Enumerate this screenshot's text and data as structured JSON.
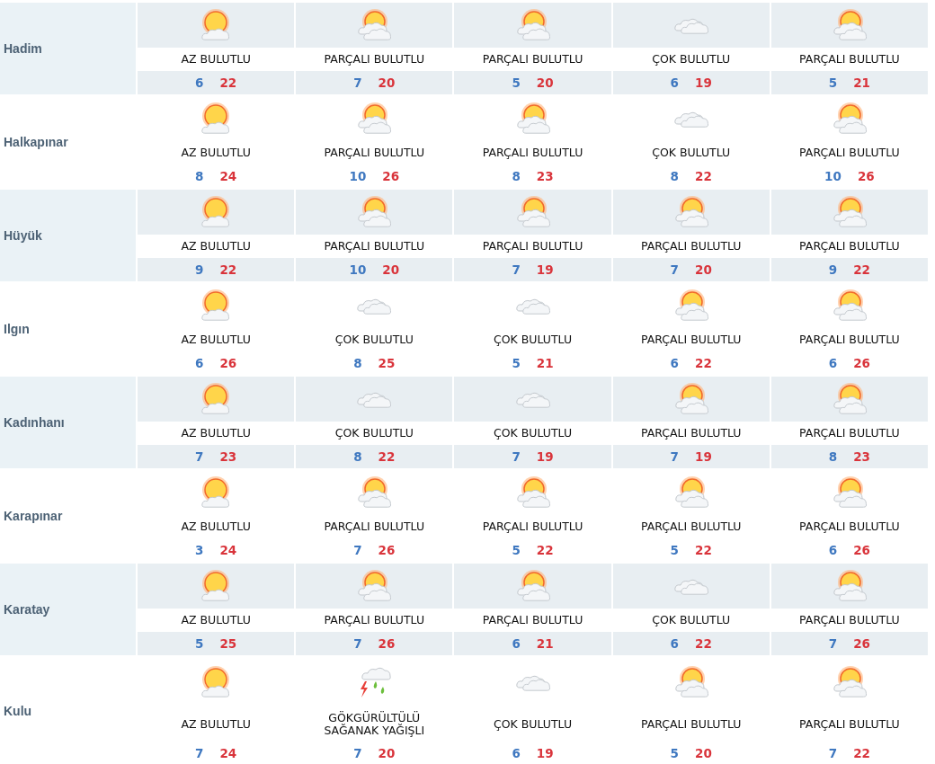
{
  "cities": [
    {
      "name": "Hadim",
      "days": [
        {
          "kind": "few",
          "condition": "AZ BULUTLU",
          "low": "6",
          "high": "22"
        },
        {
          "kind": "partly",
          "condition": "PARÇALI BULUTLU",
          "low": "7",
          "high": "20"
        },
        {
          "kind": "partly",
          "condition": "PARÇALI BULUTLU",
          "low": "5",
          "high": "20"
        },
        {
          "kind": "cloudy",
          "condition": "ÇOK BULUTLU",
          "low": "6",
          "high": "19"
        },
        {
          "kind": "partly",
          "condition": "PARÇALI BULUTLU",
          "low": "5",
          "high": "21"
        }
      ]
    },
    {
      "name": "Halkapınar",
      "days": [
        {
          "kind": "few",
          "condition": "AZ BULUTLU",
          "low": "8",
          "high": "24"
        },
        {
          "kind": "partly",
          "condition": "PARÇALI BULUTLU",
          "low": "10",
          "high": "26"
        },
        {
          "kind": "partly",
          "condition": "PARÇALI BULUTLU",
          "low": "8",
          "high": "23"
        },
        {
          "kind": "cloudy",
          "condition": "ÇOK BULUTLU",
          "low": "8",
          "high": "22"
        },
        {
          "kind": "partly",
          "condition": "PARÇALI BULUTLU",
          "low": "10",
          "high": "26"
        }
      ]
    },
    {
      "name": "Hüyük",
      "days": [
        {
          "kind": "few",
          "condition": "AZ BULUTLU",
          "low": "9",
          "high": "22"
        },
        {
          "kind": "partly",
          "condition": "PARÇALI BULUTLU",
          "low": "10",
          "high": "20"
        },
        {
          "kind": "partly",
          "condition": "PARÇALI BULUTLU",
          "low": "7",
          "high": "19"
        },
        {
          "kind": "partly",
          "condition": "PARÇALI BULUTLU",
          "low": "7",
          "high": "20"
        },
        {
          "kind": "partly",
          "condition": "PARÇALI BULUTLU",
          "low": "9",
          "high": "22"
        }
      ]
    },
    {
      "name": "Ilgın",
      "days": [
        {
          "kind": "few",
          "condition": "AZ BULUTLU",
          "low": "6",
          "high": "26"
        },
        {
          "kind": "cloudy",
          "condition": "ÇOK BULUTLU",
          "low": "8",
          "high": "25"
        },
        {
          "kind": "cloudy",
          "condition": "ÇOK BULUTLU",
          "low": "5",
          "high": "21"
        },
        {
          "kind": "partly",
          "condition": "PARÇALI BULUTLU",
          "low": "6",
          "high": "22"
        },
        {
          "kind": "partly",
          "condition": "PARÇALI BULUTLU",
          "low": "6",
          "high": "26"
        }
      ]
    },
    {
      "name": "Kadınhanı",
      "days": [
        {
          "kind": "few",
          "condition": "AZ BULUTLU",
          "low": "7",
          "high": "23"
        },
        {
          "kind": "cloudy",
          "condition": "ÇOK BULUTLU",
          "low": "8",
          "high": "22"
        },
        {
          "kind": "cloudy",
          "condition": "ÇOK BULUTLU",
          "low": "7",
          "high": "19"
        },
        {
          "kind": "partly",
          "condition": "PARÇALI BULUTLU",
          "low": "7",
          "high": "19"
        },
        {
          "kind": "partly",
          "condition": "PARÇALI BULUTLU",
          "low": "8",
          "high": "23"
        }
      ]
    },
    {
      "name": "Karapınar",
      "days": [
        {
          "kind": "few",
          "condition": "AZ BULUTLU",
          "low": "3",
          "high": "24"
        },
        {
          "kind": "partly",
          "condition": "PARÇALI BULUTLU",
          "low": "7",
          "high": "26"
        },
        {
          "kind": "partly",
          "condition": "PARÇALI BULUTLU",
          "low": "5",
          "high": "22"
        },
        {
          "kind": "partly",
          "condition": "PARÇALI BULUTLU",
          "low": "5",
          "high": "22"
        },
        {
          "kind": "partly",
          "condition": "PARÇALI BULUTLU",
          "low": "6",
          "high": "26"
        }
      ]
    },
    {
      "name": "Karatay",
      "days": [
        {
          "kind": "few",
          "condition": "AZ BULUTLU",
          "low": "5",
          "high": "25"
        },
        {
          "kind": "partly",
          "condition": "PARÇALI BULUTLU",
          "low": "7",
          "high": "26"
        },
        {
          "kind": "partly",
          "condition": "PARÇALI BULUTLU",
          "low": "6",
          "high": "21"
        },
        {
          "kind": "cloudy",
          "condition": "ÇOK BULUTLU",
          "low": "6",
          "high": "22"
        },
        {
          "kind": "partly",
          "condition": "PARÇALI BULUTLU",
          "low": "7",
          "high": "26"
        }
      ]
    },
    {
      "name": "Kulu",
      "days": [
        {
          "kind": "few",
          "condition": "AZ BULUTLU",
          "low": "7",
          "high": "24"
        },
        {
          "kind": "storm",
          "condition": "GÖKGÜRÜLTÜLÜ SAĞANAK YAĞIŞLI",
          "low": "7",
          "high": "20"
        },
        {
          "kind": "cloudy",
          "condition": "ÇOK BULUTLU",
          "low": "6",
          "high": "19"
        },
        {
          "kind": "partly",
          "condition": "PARÇALI BULUTLU",
          "low": "5",
          "high": "20"
        },
        {
          "kind": "partly",
          "condition": "PARÇALI BULUTLU",
          "low": "7",
          "high": "22"
        }
      ]
    }
  ]
}
